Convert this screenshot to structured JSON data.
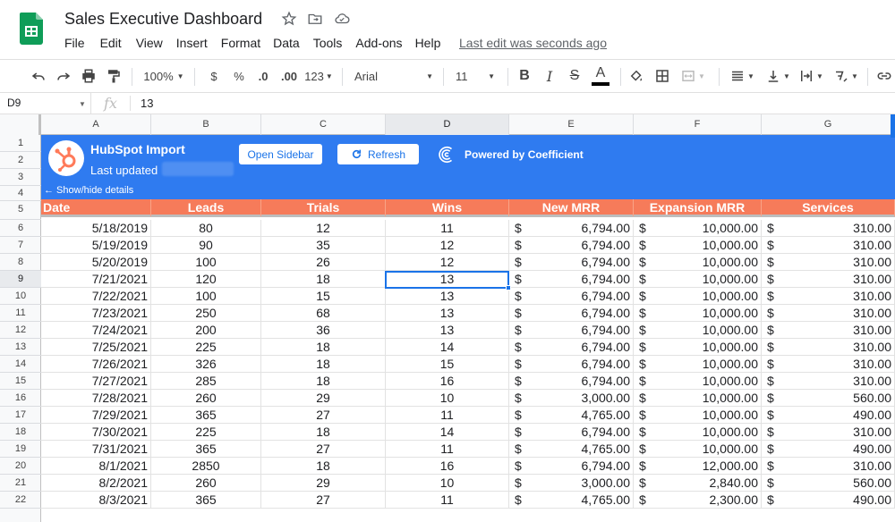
{
  "app": {
    "doc_title": "Sales Executive Dashboard",
    "menu": [
      "File",
      "Edit",
      "View",
      "Insert",
      "Format",
      "Data",
      "Tools",
      "Add-ons",
      "Help"
    ],
    "last_edit": "Last edit was seconds ago"
  },
  "toolbar": {
    "zoom": "100%",
    "currency": "$",
    "percent": "%",
    "dec_decrease": ".0",
    "dec_increase": ".00",
    "more_formats": "123",
    "font": "Arial",
    "font_size": "11",
    "bold": "B",
    "italic": "I",
    "strike": "S",
    "text_color": "A"
  },
  "formula_bar": {
    "cell_ref": "D9",
    "fx_label": "fx",
    "value": "13"
  },
  "columns": [
    "A",
    "B",
    "C",
    "D",
    "E",
    "F",
    "G"
  ],
  "row_numbers": [
    "1",
    "2",
    "3",
    "4",
    "5",
    "6",
    "7",
    "8",
    "9",
    "10",
    "11",
    "12",
    "13",
    "14",
    "15",
    "16",
    "17",
    "18",
    "19",
    "20",
    "21",
    "22"
  ],
  "selected_cell": {
    "column": "D",
    "row": "9"
  },
  "banner": {
    "title": "HubSpot Import",
    "last_updated_label": "Last updated",
    "open_sidebar": "Open Sidebar",
    "refresh": "Refresh",
    "powered_by": "Powered by Coefficient",
    "show_hide": "← Show/hide details"
  },
  "colors": {
    "banner_blue": "#2f7bf0",
    "header_orange": "#f67b5a",
    "selection_blue": "#1a73e8",
    "sheets_green": "#0f9d58",
    "hubspot_orange": "#ff7a59"
  },
  "table": {
    "headers": [
      "Date",
      "Leads",
      "Trials",
      "Wins",
      "New MRR",
      "Expansion MRR",
      "Services"
    ],
    "currency_symbol": "$",
    "rows": [
      [
        "5/18/2019",
        "80",
        "12",
        "11",
        "6,794.00",
        "10,000.00",
        "310.00"
      ],
      [
        "5/19/2019",
        "90",
        "35",
        "12",
        "6,794.00",
        "10,000.00",
        "310.00"
      ],
      [
        "5/20/2019",
        "100",
        "26",
        "12",
        "6,794.00",
        "10,000.00",
        "310.00"
      ],
      [
        "7/21/2021",
        "120",
        "18",
        "13",
        "6,794.00",
        "10,000.00",
        "310.00"
      ],
      [
        "7/22/2021",
        "100",
        "15",
        "13",
        "6,794.00",
        "10,000.00",
        "310.00"
      ],
      [
        "7/23/2021",
        "250",
        "68",
        "13",
        "6,794.00",
        "10,000.00",
        "310.00"
      ],
      [
        "7/24/2021",
        "200",
        "36",
        "13",
        "6,794.00",
        "10,000.00",
        "310.00"
      ],
      [
        "7/25/2021",
        "225",
        "18",
        "14",
        "6,794.00",
        "10,000.00",
        "310.00"
      ],
      [
        "7/26/2021",
        "326",
        "18",
        "15",
        "6,794.00",
        "10,000.00",
        "310.00"
      ],
      [
        "7/27/2021",
        "285",
        "18",
        "16",
        "6,794.00",
        "10,000.00",
        "310.00"
      ],
      [
        "7/28/2021",
        "260",
        "29",
        "10",
        "3,000.00",
        "10,000.00",
        "560.00"
      ],
      [
        "7/29/2021",
        "365",
        "27",
        "11",
        "4,765.00",
        "10,000.00",
        "490.00"
      ],
      [
        "7/30/2021",
        "225",
        "18",
        "14",
        "6,794.00",
        "10,000.00",
        "310.00"
      ],
      [
        "7/31/2021",
        "365",
        "27",
        "11",
        "4,765.00",
        "10,000.00",
        "490.00"
      ],
      [
        "8/1/2021",
        "2850",
        "18",
        "16",
        "6,794.00",
        "12,000.00",
        "310.00"
      ],
      [
        "8/2/2021",
        "260",
        "29",
        "10",
        "3,000.00",
        "2,840.00",
        "560.00"
      ],
      [
        "8/3/2021",
        "365",
        "27",
        "11",
        "4,765.00",
        "2,300.00",
        "490.00"
      ]
    ]
  }
}
